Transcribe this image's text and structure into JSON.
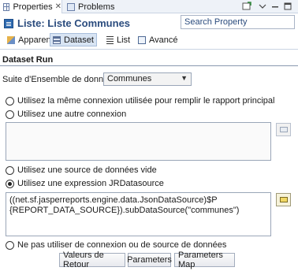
{
  "tabs": {
    "properties": "Properties",
    "problems": "Problems",
    "close_glyph": "✕"
  },
  "title": "Liste: Liste Communes",
  "search": {
    "placeholder": "Search Property"
  },
  "subtabs": [
    "Apparence",
    "Dataset",
    "List",
    "Avancé"
  ],
  "section": {
    "title": "Dataset Run",
    "suite_label": "Suite d'Ensemble de données",
    "suite_value": "Communes"
  },
  "radios": {
    "same_connection": "Utilisez la même connexion utilisée pour remplir le rapport principal",
    "other_connection": "Utilisez une autre connexion",
    "empty_source": "Utilisez une source de données vide",
    "jr_expression": "Utilisez une expression JRDatasource",
    "no_connection": "Ne pas utiliser de connexion ou de source de données"
  },
  "expression": "((net.sf.jasperreports.engine.data.JsonDataSource)$P\n{REPORT_DATA_SOURCE}).subDataSource(\"communes\")",
  "buttons": {
    "return_values": "Valeurs de Retour",
    "parameters": "Parameters",
    "parameters_map": "Parameters Map"
  }
}
